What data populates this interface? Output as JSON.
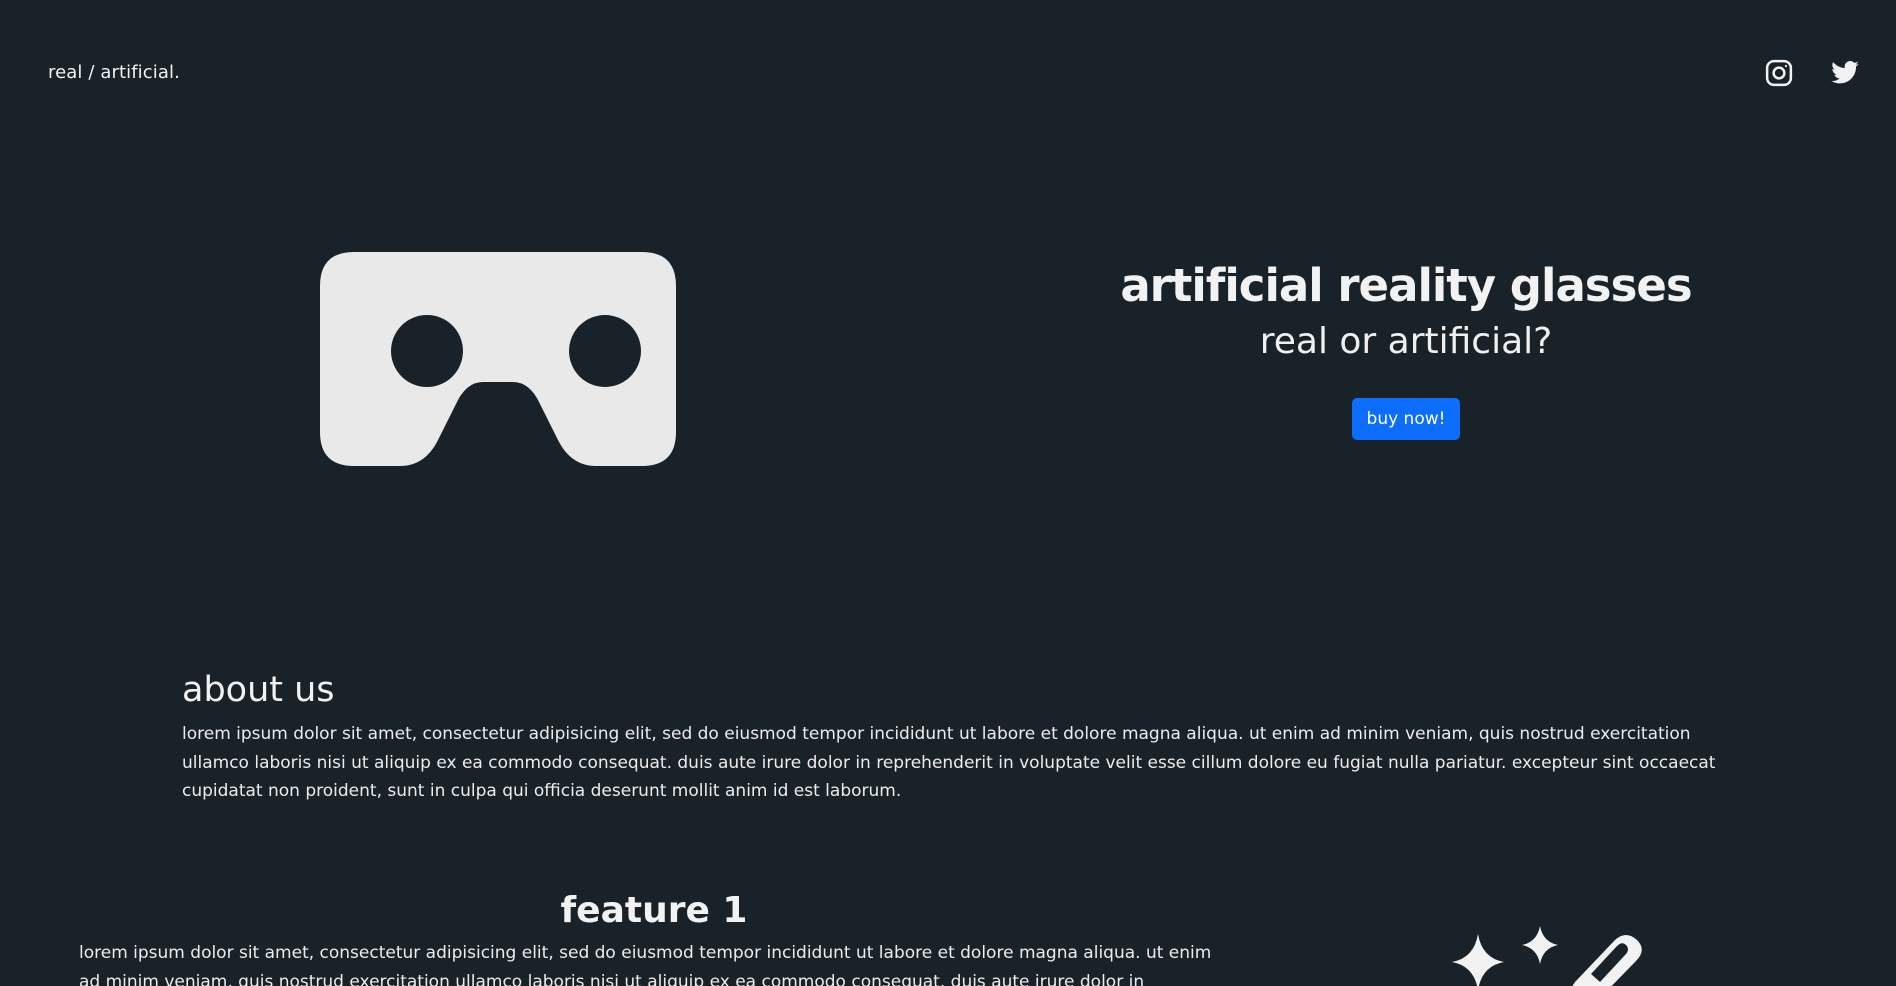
{
  "header": {
    "brand": "real / artificial.",
    "social": [
      {
        "icon": "instagram-icon"
      },
      {
        "icon": "twitter-icon"
      }
    ]
  },
  "hero": {
    "image_icon": "vr-headset-icon",
    "title": "artificial reality glasses",
    "subtitle": "real or artificial?",
    "button_label": "buy now!"
  },
  "about": {
    "heading": "about us",
    "text": "lorem ipsum dolor sit amet, consectetur adipisicing elit, sed do eiusmod tempor incididunt ut labore et dolore magna aliqua. ut enim ad minim veniam, quis nostrud exercitation ullamco laboris nisi ut aliquip ex ea commodo consequat. duis aute irure dolor in reprehenderit in voluptate velit esse cillum dolore eu fugiat nulla pariatur. excepteur sint occaecat cupidatat non proident, sunt in culpa qui officia deserunt mollit anim id est laborum."
  },
  "feature1": {
    "heading": "feature 1",
    "text": "lorem ipsum dolor sit amet, consectetur adipisicing elit, sed do eiusmod tempor incididunt ut labore et dolore magna aliqua. ut enim ad minim veniam, quis nostrud exercitation ullamco laboris nisi ut aliquip ex ea commodo consequat. duis aute irure dolor in reprehenderit in voluptate velit esse cillum dolore eu fugiat nulla pariatur.",
    "icon": "magic-wand-sparkles-icon"
  },
  "colors": {
    "background": "#1a2229",
    "accent": "#0d6efd",
    "text": "#f2f2f2"
  }
}
